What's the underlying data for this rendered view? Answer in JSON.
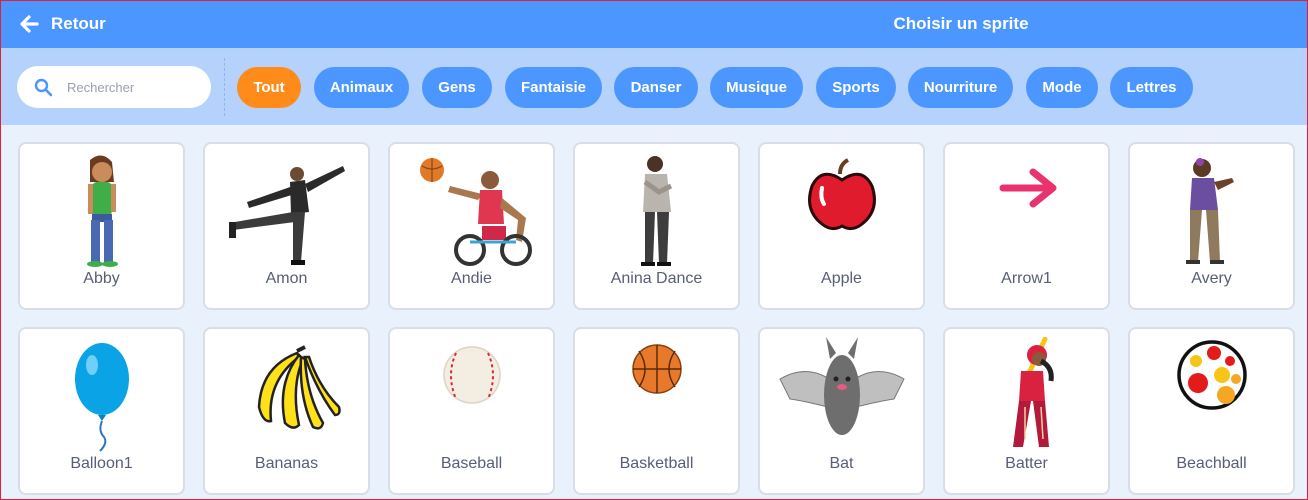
{
  "header": {
    "back_label": "Retour",
    "back_icon": "arrow-left-icon",
    "title": "Choisir un sprite"
  },
  "search": {
    "placeholder": "Rechercher",
    "value": "",
    "icon": "search-icon"
  },
  "tags": [
    {
      "label": "Tout",
      "active": true
    },
    {
      "label": "Animaux",
      "active": false
    },
    {
      "label": "Gens",
      "active": false
    },
    {
      "label": "Fantaisie",
      "active": false
    },
    {
      "label": "Danser",
      "active": false
    },
    {
      "label": "Musique",
      "active": false
    },
    {
      "label": "Sports",
      "active": false
    },
    {
      "label": "Nourriture",
      "active": false
    },
    {
      "label": "Mode",
      "active": false
    },
    {
      "label": "Lettres",
      "active": false
    }
  ],
  "sprites": [
    {
      "name": "Abby",
      "icon": "abby-sprite-icon"
    },
    {
      "name": "Amon",
      "icon": "amon-sprite-icon"
    },
    {
      "name": "Andie",
      "icon": "andie-sprite-icon"
    },
    {
      "name": "Anina Dance",
      "icon": "anina-dance-sprite-icon"
    },
    {
      "name": "Apple",
      "icon": "apple-sprite-icon"
    },
    {
      "name": "Arrow1",
      "icon": "arrow1-sprite-icon"
    },
    {
      "name": "Avery",
      "icon": "avery-sprite-icon"
    },
    {
      "name": "Balloon1",
      "icon": "balloon1-sprite-icon"
    },
    {
      "name": "Bananas",
      "icon": "bananas-sprite-icon"
    },
    {
      "name": "Baseball",
      "icon": "baseball-sprite-icon"
    },
    {
      "name": "Basketball",
      "icon": "basketball-sprite-icon"
    },
    {
      "name": "Bat",
      "icon": "bat-sprite-icon"
    },
    {
      "name": "Batter",
      "icon": "batter-sprite-icon"
    },
    {
      "name": "Beachball",
      "icon": "beachball-sprite-icon"
    }
  ],
  "colors": {
    "header": "#4c97ff",
    "filterbar": "#b4d2fc",
    "background": "#e9f1fc",
    "tag": "#4c97ff",
    "tag_active": "#ff8c1a",
    "text": "#575e75"
  }
}
